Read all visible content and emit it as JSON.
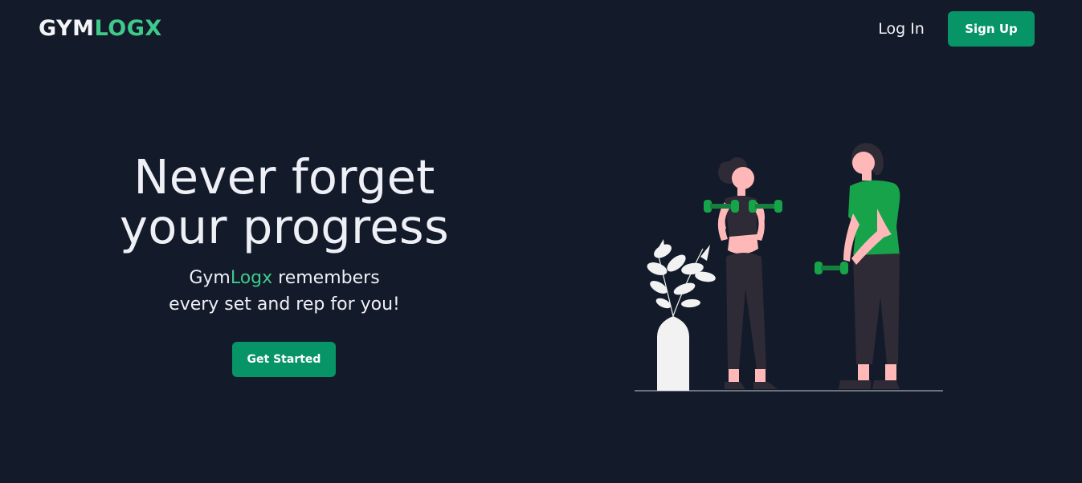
{
  "header": {
    "logo_part1": "GYM",
    "logo_part2": "LOGX",
    "login_label": "Log In",
    "signup_label": "Sign Up"
  },
  "hero": {
    "title_line1": "Never forget",
    "title_line2": "your progress",
    "sub_brand_part1": "Gym",
    "sub_brand_part2": "Logx",
    "sub_line1_rest": " remembers",
    "sub_line2": "every set and rep for you!",
    "cta_label": "Get Started"
  },
  "colors": {
    "background": "#131a29",
    "accent": "#079467",
    "brand_green": "#3fc98a",
    "text": "#eef0f6"
  },
  "icons": {
    "illustration": "two-people-lifting-dumbbells-with-plant"
  }
}
